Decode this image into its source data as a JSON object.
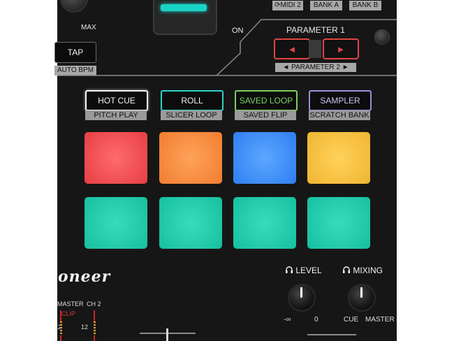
{
  "top": {
    "max_label": "MAX",
    "on_label": "ON",
    "tap_label": "TAP",
    "auto_bpm_label": "AUTO BPM",
    "midi_label": "MIDI 2",
    "bank_a_label": "BANK A",
    "bank_b_label": "BANK B"
  },
  "parameter": {
    "title": "PARAMETER 1",
    "sub_label": "PARAMETER 2",
    "left_arrow": "◄",
    "right_arrow": "►",
    "small_left": "◄",
    "small_right": "►"
  },
  "modes": [
    {
      "label": "HOT CUE",
      "sub": "PITCH PLAY",
      "color": "#f5f5f5"
    },
    {
      "label": "ROLL",
      "sub": "SLICER LOOP",
      "color": "#2ed3c5"
    },
    {
      "label": "SAVED LOOP",
      "sub": "SAVED FLIP",
      "color": "#7bd15f"
    },
    {
      "label": "SAMPLER",
      "sub": "SCRATCH BANK",
      "color": "#9a8fd8"
    }
  ],
  "pads": {
    "row1": [
      {
        "name": "pad-1",
        "color": "#f04b4f"
      },
      {
        "name": "pad-2",
        "color": "#f58a3a"
      },
      {
        "name": "pad-3",
        "color": "#3d8cf7"
      },
      {
        "name": "pad-4",
        "color": "#f3c03f"
      }
    ],
    "row2": [
      {
        "name": "pad-5",
        "color": "#1fc6a6"
      },
      {
        "name": "pad-6",
        "color": "#1fc6a6"
      },
      {
        "name": "pad-7",
        "color": "#1fc6a6"
      },
      {
        "name": "pad-8",
        "color": "#1fc6a6"
      }
    ]
  },
  "brand": "Pioneer DJ",
  "meter": {
    "master_label": "MASTER",
    "ch2_label": "CH 2",
    "clip_label": "CLIP",
    "level_12": "12",
    "level_12b": "12"
  },
  "headphones": {
    "level_label": "LEVEL",
    "mixing_label": "MIXING",
    "level_min": "-∞",
    "level_max": "0",
    "mixing_min": "CUE",
    "mixing_max": "MASTER",
    "headphone_icon": "headphones-icon"
  }
}
